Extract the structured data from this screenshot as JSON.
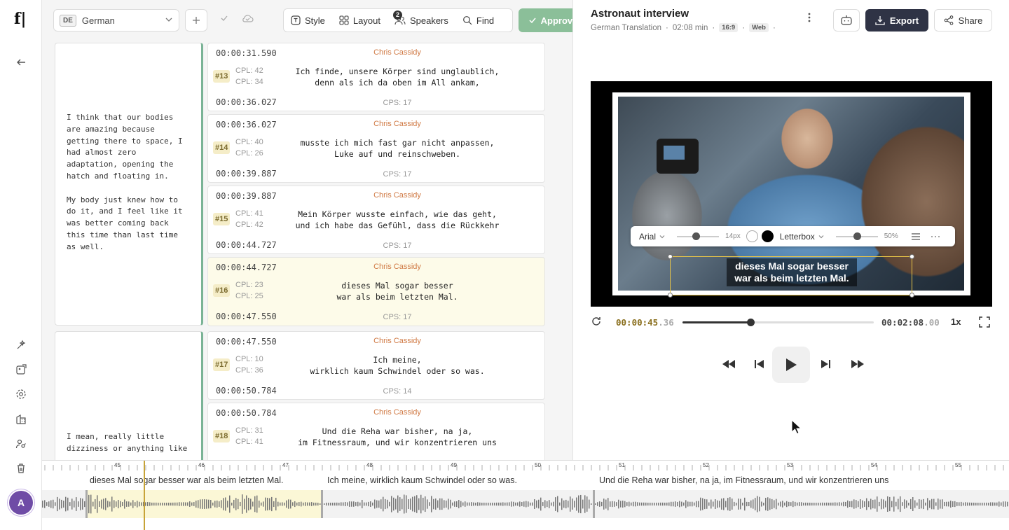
{
  "rail": {
    "logo": "f|",
    "avatar_initial": "A",
    "icons": [
      "back-arrow-icon",
      "wand-icon",
      "image-gallery-icon",
      "settings-icon",
      "building-icon",
      "user-key-icon",
      "trash-icon"
    ]
  },
  "toolbar": {
    "lang_code": "DE",
    "lang_name": "German",
    "style_label": "Style",
    "layout_label": "Layout",
    "speakers_label": "Speakers",
    "speakers_count": "2",
    "find_label": "Find",
    "approve_label": "Approve"
  },
  "source_blocks": [
    {
      "text": "I think that our bodies\nare amazing because\ngetting there to space, I\nhad almost zero\nadaptation, opening the\nhatch and floating in.\n\nMy body just knew how to\ndo it, and I feel like it\nwas better coming back\nthis time than last time\nas well."
    },
    {
      "text": "I mean, really little\ndizziness or anything like"
    }
  ],
  "segments": [
    {
      "num": "#13",
      "start": "00:00:31.590",
      "end": "00:00:36.027",
      "speaker": "Chris Cassidy",
      "cpl1": "CPL: 42",
      "cpl2": "CPL: 34",
      "line1": "Ich finde, unsere Körper sind unglaublich,",
      "line2": "denn als ich da oben im All ankam,",
      "cps": "CPS: 17"
    },
    {
      "num": "#14",
      "start": "00:00:36.027",
      "end": "00:00:39.887",
      "speaker": "Chris Cassidy",
      "cpl1": "CPL: 40",
      "cpl2": "CPL: 26",
      "line1": "musste ich mich fast gar nicht anpassen,",
      "line2": "Luke auf und reinschweben.",
      "cps": "CPS: 17"
    },
    {
      "num": "#15",
      "start": "00:00:39.887",
      "end": "00:00:44.727",
      "speaker": "Chris Cassidy",
      "cpl1": "CPL: 41",
      "cpl2": "CPL: 42",
      "line1": "Mein Körper wusste einfach, wie das geht,",
      "line2": "und ich habe das Gefühl, dass die Rückkehr",
      "cps": "CPS: 17"
    },
    {
      "num": "#16",
      "start": "00:00:44.727",
      "end": "00:00:47.550",
      "speaker": "Chris Cassidy",
      "cpl1": "CPL: 23",
      "cpl2": "CPL: 25",
      "line1": "dieses Mal sogar besser",
      "line2": "war als beim letzten Mal.",
      "cps": "CPS: 17"
    },
    {
      "num": "#17",
      "start": "00:00:47.550",
      "end": "00:00:50.784",
      "speaker": "Chris Cassidy",
      "cpl1": "CPL: 10",
      "cpl2": "CPL: 36",
      "line1": "Ich meine,",
      "line2": "wirklich kaum Schwindel oder so was.",
      "cps": "CPS: 14"
    },
    {
      "num": "#18",
      "start": "00:00:50.784",
      "end": "",
      "speaker": "Chris Cassidy",
      "cpl1": "CPL: 31",
      "cpl2": "CPL: 41",
      "line1": "Und die Reha war bisher, na ja,",
      "line2": "im Fitnessraum, und wir konzentrieren uns",
      "cps": ""
    }
  ],
  "header": {
    "title": "Astronaut interview",
    "subtitle": "German Translation",
    "duration": "02:08 min",
    "aspect": "16:9",
    "platform": "Web",
    "dot": "·",
    "export_label": "Export",
    "share_label": "Share"
  },
  "style_bar": {
    "font": "Arial",
    "font_size": "14px",
    "mode": "Letterbox",
    "opacity": "50%",
    "font_size_slider_level": 0.45,
    "opacity_slider_level": 0.5
  },
  "video": {
    "subtitle_line1": "dieses Mal sogar besser",
    "subtitle_line2": "war als beim letzten Mal."
  },
  "player": {
    "current_main": "00:00:45",
    "current_frac": ".36",
    "total_main": "00:02:08",
    "total_frac": ".00",
    "speed": "1x",
    "progress": 0.354
  },
  "timeline": {
    "ticks": [
      "45",
      "46",
      "47",
      "48",
      "49",
      "50",
      "51",
      "52",
      "53",
      "54",
      "55"
    ],
    "captions": [
      "dieses Mal sogar besser war als beim letzten Mal.",
      "Ich meine, wirklich kaum Schwindel oder so was.",
      "Und die Reha war bisher, na ja, im Fitnessraum, und wir konzentrieren uns"
    ]
  },
  "colors": {
    "accent": "#2f3345",
    "approve": "#8bbf99",
    "speaker": "#d07a45",
    "highlight": "#fdfbe9",
    "avatar": "#6f4ca6"
  }
}
